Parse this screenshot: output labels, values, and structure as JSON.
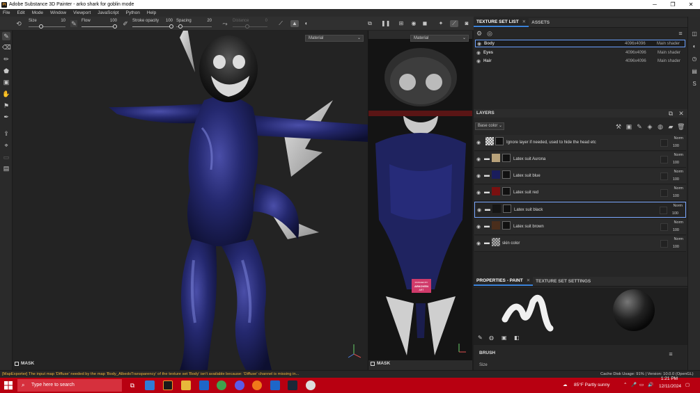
{
  "window": {
    "title": "Adobe Substance 3D Painter - arko shark for goblin mode",
    "minimize": "─",
    "maximize": "❐",
    "close": "✕"
  },
  "menu": [
    "File",
    "Edit",
    "Mode",
    "Window",
    "Viewport",
    "JavaScript",
    "Python",
    "Help"
  ],
  "tool_options": {
    "size_label": "Size",
    "size_value": "10",
    "flow_label": "Flow",
    "flow_value": "100",
    "stroke_opacity_label": "Stroke opacity",
    "stroke_opacity_value": "100",
    "spacing_label": "Spacing",
    "spacing_value": "20",
    "distance_label": "Distance",
    "distance_value": "0"
  },
  "viewport3d": {
    "channel": "Material",
    "mask_label": "MASK"
  },
  "viewport2d": {
    "channel": "Material",
    "mask_label": "MASK"
  },
  "texture_set_panel": {
    "tab_active": "TEXTURE SET LIST",
    "tab_other": "ASSETS",
    "rows": [
      {
        "name": "Body",
        "resolution": "4096x4096",
        "shader": "Main shader"
      },
      {
        "name": "Eyes",
        "resolution": "4096x4096",
        "shader": "Main shader"
      },
      {
        "name": "Hair",
        "resolution": "4096x4096",
        "shader": "Main shader"
      }
    ]
  },
  "layers_panel": {
    "title": "LAYERS",
    "channel": "Base color",
    "layers": [
      {
        "name": "Ignore layer if needed, used to hide the head etc",
        "blend": "Norm",
        "opacity": "100",
        "color": "#cccccc",
        "folder": false
      },
      {
        "name": "Latex suit Aurona",
        "blend": "Norm",
        "opacity": "100",
        "color": "#b8a27a",
        "folder": true
      },
      {
        "name": "Latex suit blue",
        "blend": "Norm",
        "opacity": "100",
        "color": "#1a1d5c",
        "folder": true
      },
      {
        "name": "Latex suit red",
        "blend": "Norm",
        "opacity": "100",
        "color": "#7a1010",
        "folder": true
      },
      {
        "name": "Latex suit black",
        "blend": "Norm",
        "opacity": "100",
        "color": "#151515",
        "folder": true
      },
      {
        "name": "Latex suit brown",
        "blend": "Norm",
        "opacity": "100",
        "color": "#4a2e1c",
        "folder": true
      },
      {
        "name": "skin color",
        "blend": "Norm",
        "opacity": "100",
        "color": "#9a9a9a",
        "folder": true
      }
    ]
  },
  "properties_panel": {
    "tab_active": "PROPERTIES - PAINT",
    "tab_other": "TEXTURE SET SETTINGS",
    "brush_label": "BRUSH",
    "size_label": "Size"
  },
  "status": {
    "error": "[MapExporter] The input map 'Diffuse' needed by the map 'Body_AlbedoTransparency' of the texture set 'Body' isn't available because: 'Diffuse' channel is missing in...",
    "cache": "Cache Disk Usage:   91% | Version: 10.0.0 (OpenGL)"
  },
  "taskbar": {
    "search_placeholder": "Type here to search",
    "weather": "85°F  Partly sunny",
    "time": "1:21 PM",
    "date": "12/11/2024"
  },
  "uv_badge": "FINISHED BY\nARKOVEN\nART"
}
